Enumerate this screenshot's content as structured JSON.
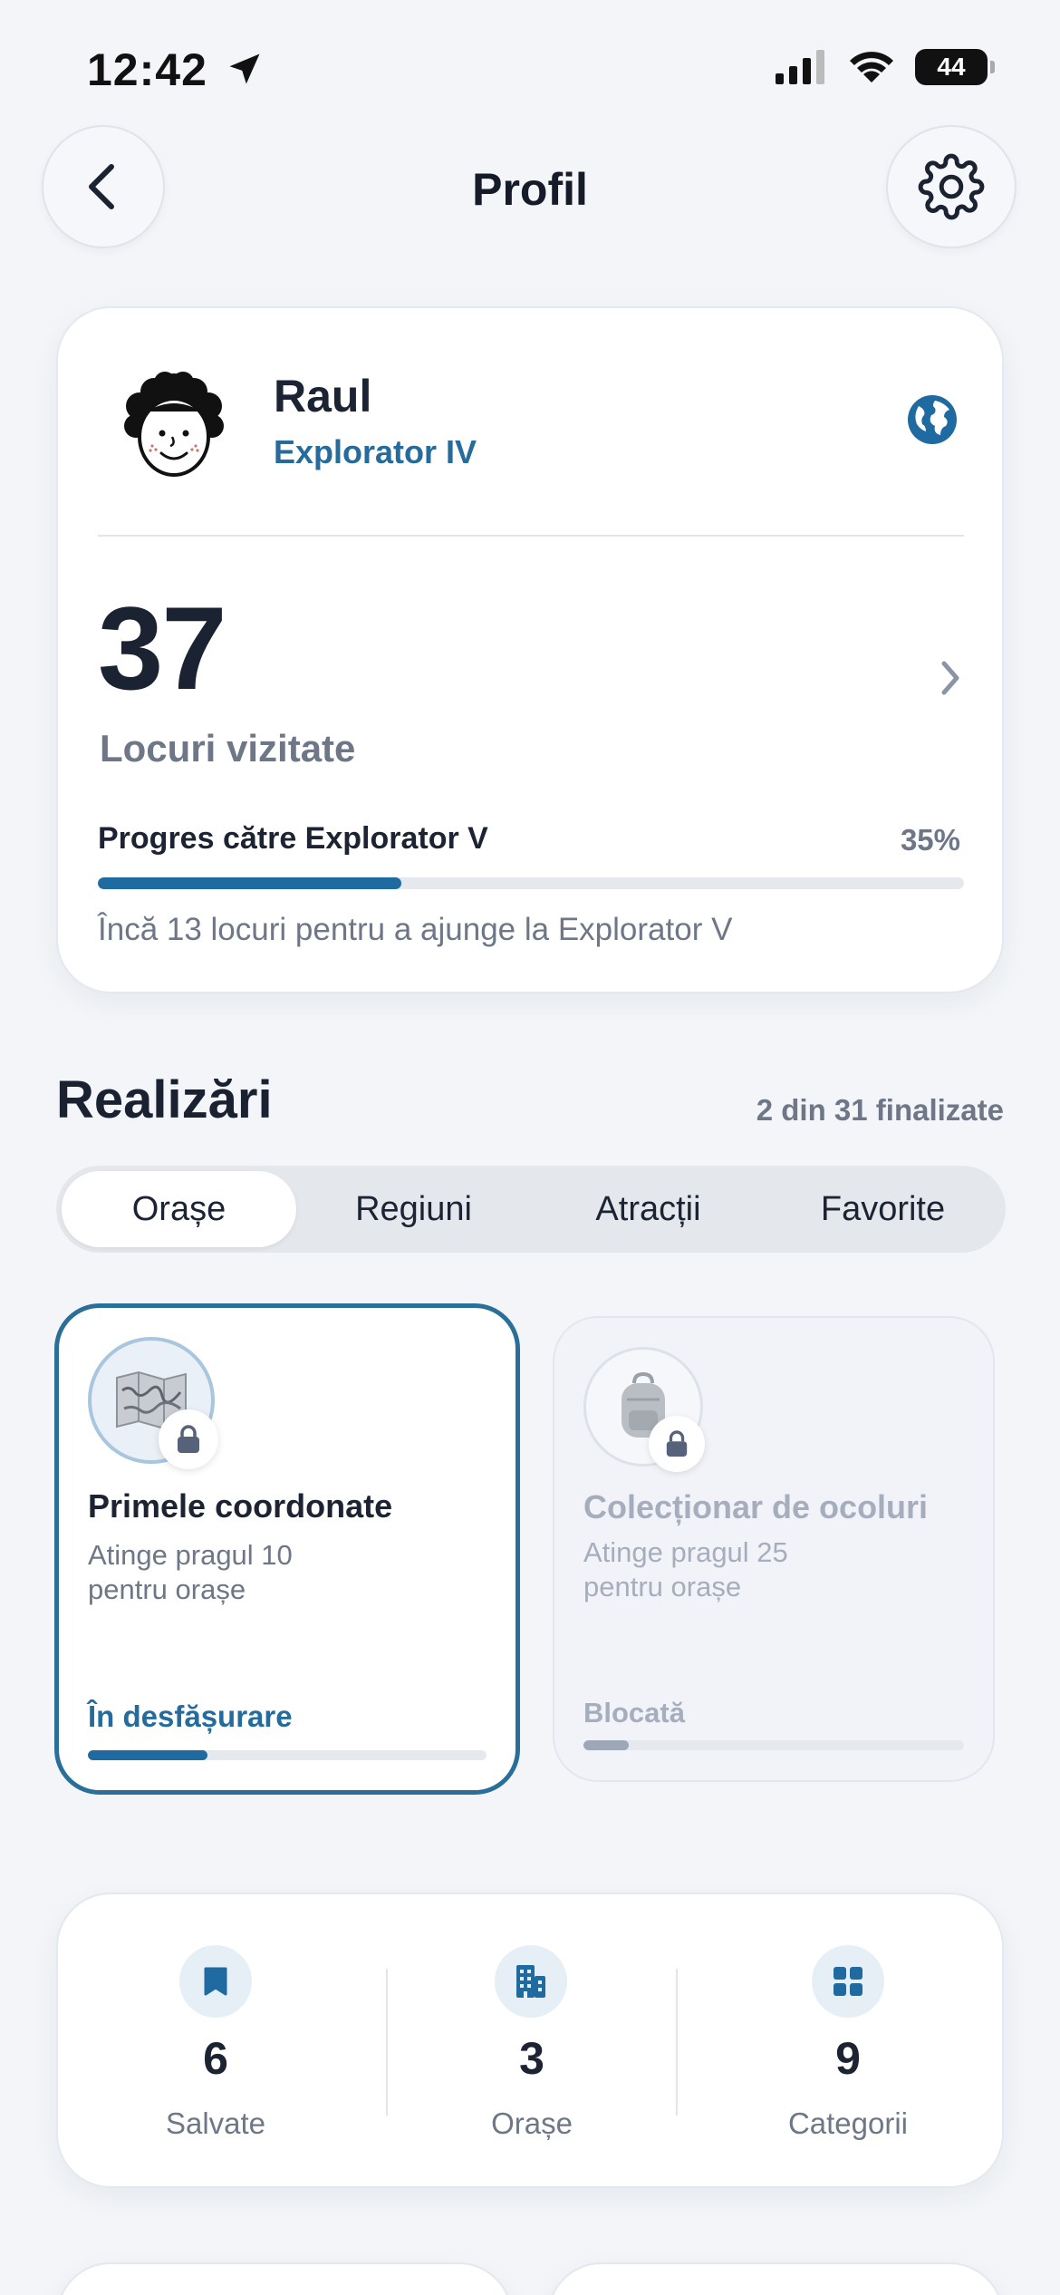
{
  "status_bar": {
    "time": "12:42",
    "battery": "44"
  },
  "header": {
    "title": "Profil"
  },
  "profile": {
    "name": "Raul",
    "level": "Explorator IV",
    "visited_count": "37",
    "visited_label": "Locuri vizitate",
    "progress_label": "Progres către Explorator V",
    "progress_percent_text": "35%",
    "progress_value": 0.35,
    "hint": "Încă 13 locuri pentru a ajunge la Explorator V"
  },
  "achievements": {
    "title": "Realizări",
    "summary": "2 din 31 finalizate",
    "tabs": [
      "Orașe",
      "Regiuni",
      "Atracții",
      "Favorite"
    ],
    "active_tab": 0,
    "cards": [
      {
        "title": "Primele coordonate",
        "desc_line1": "Atinge pragul 10",
        "desc_line2": "pentru orașe",
        "status": "În desfășurare",
        "progress": 0.3
      },
      {
        "title": "Colecționar de ocoluri",
        "desc_line1": "Atinge pragul 25",
        "desc_line2": "pentru orașe",
        "status": "Blocată",
        "progress": 0.12
      }
    ]
  },
  "stats": [
    {
      "value": "6",
      "label": "Salvate",
      "icon": "bookmark-icon"
    },
    {
      "value": "3",
      "label": "Orașe",
      "icon": "building-icon"
    },
    {
      "value": "9",
      "label": "Categorii",
      "icon": "grid-icon"
    }
  ],
  "colors": {
    "accent": "#1f6aa0",
    "background": "#f3f5f8"
  }
}
